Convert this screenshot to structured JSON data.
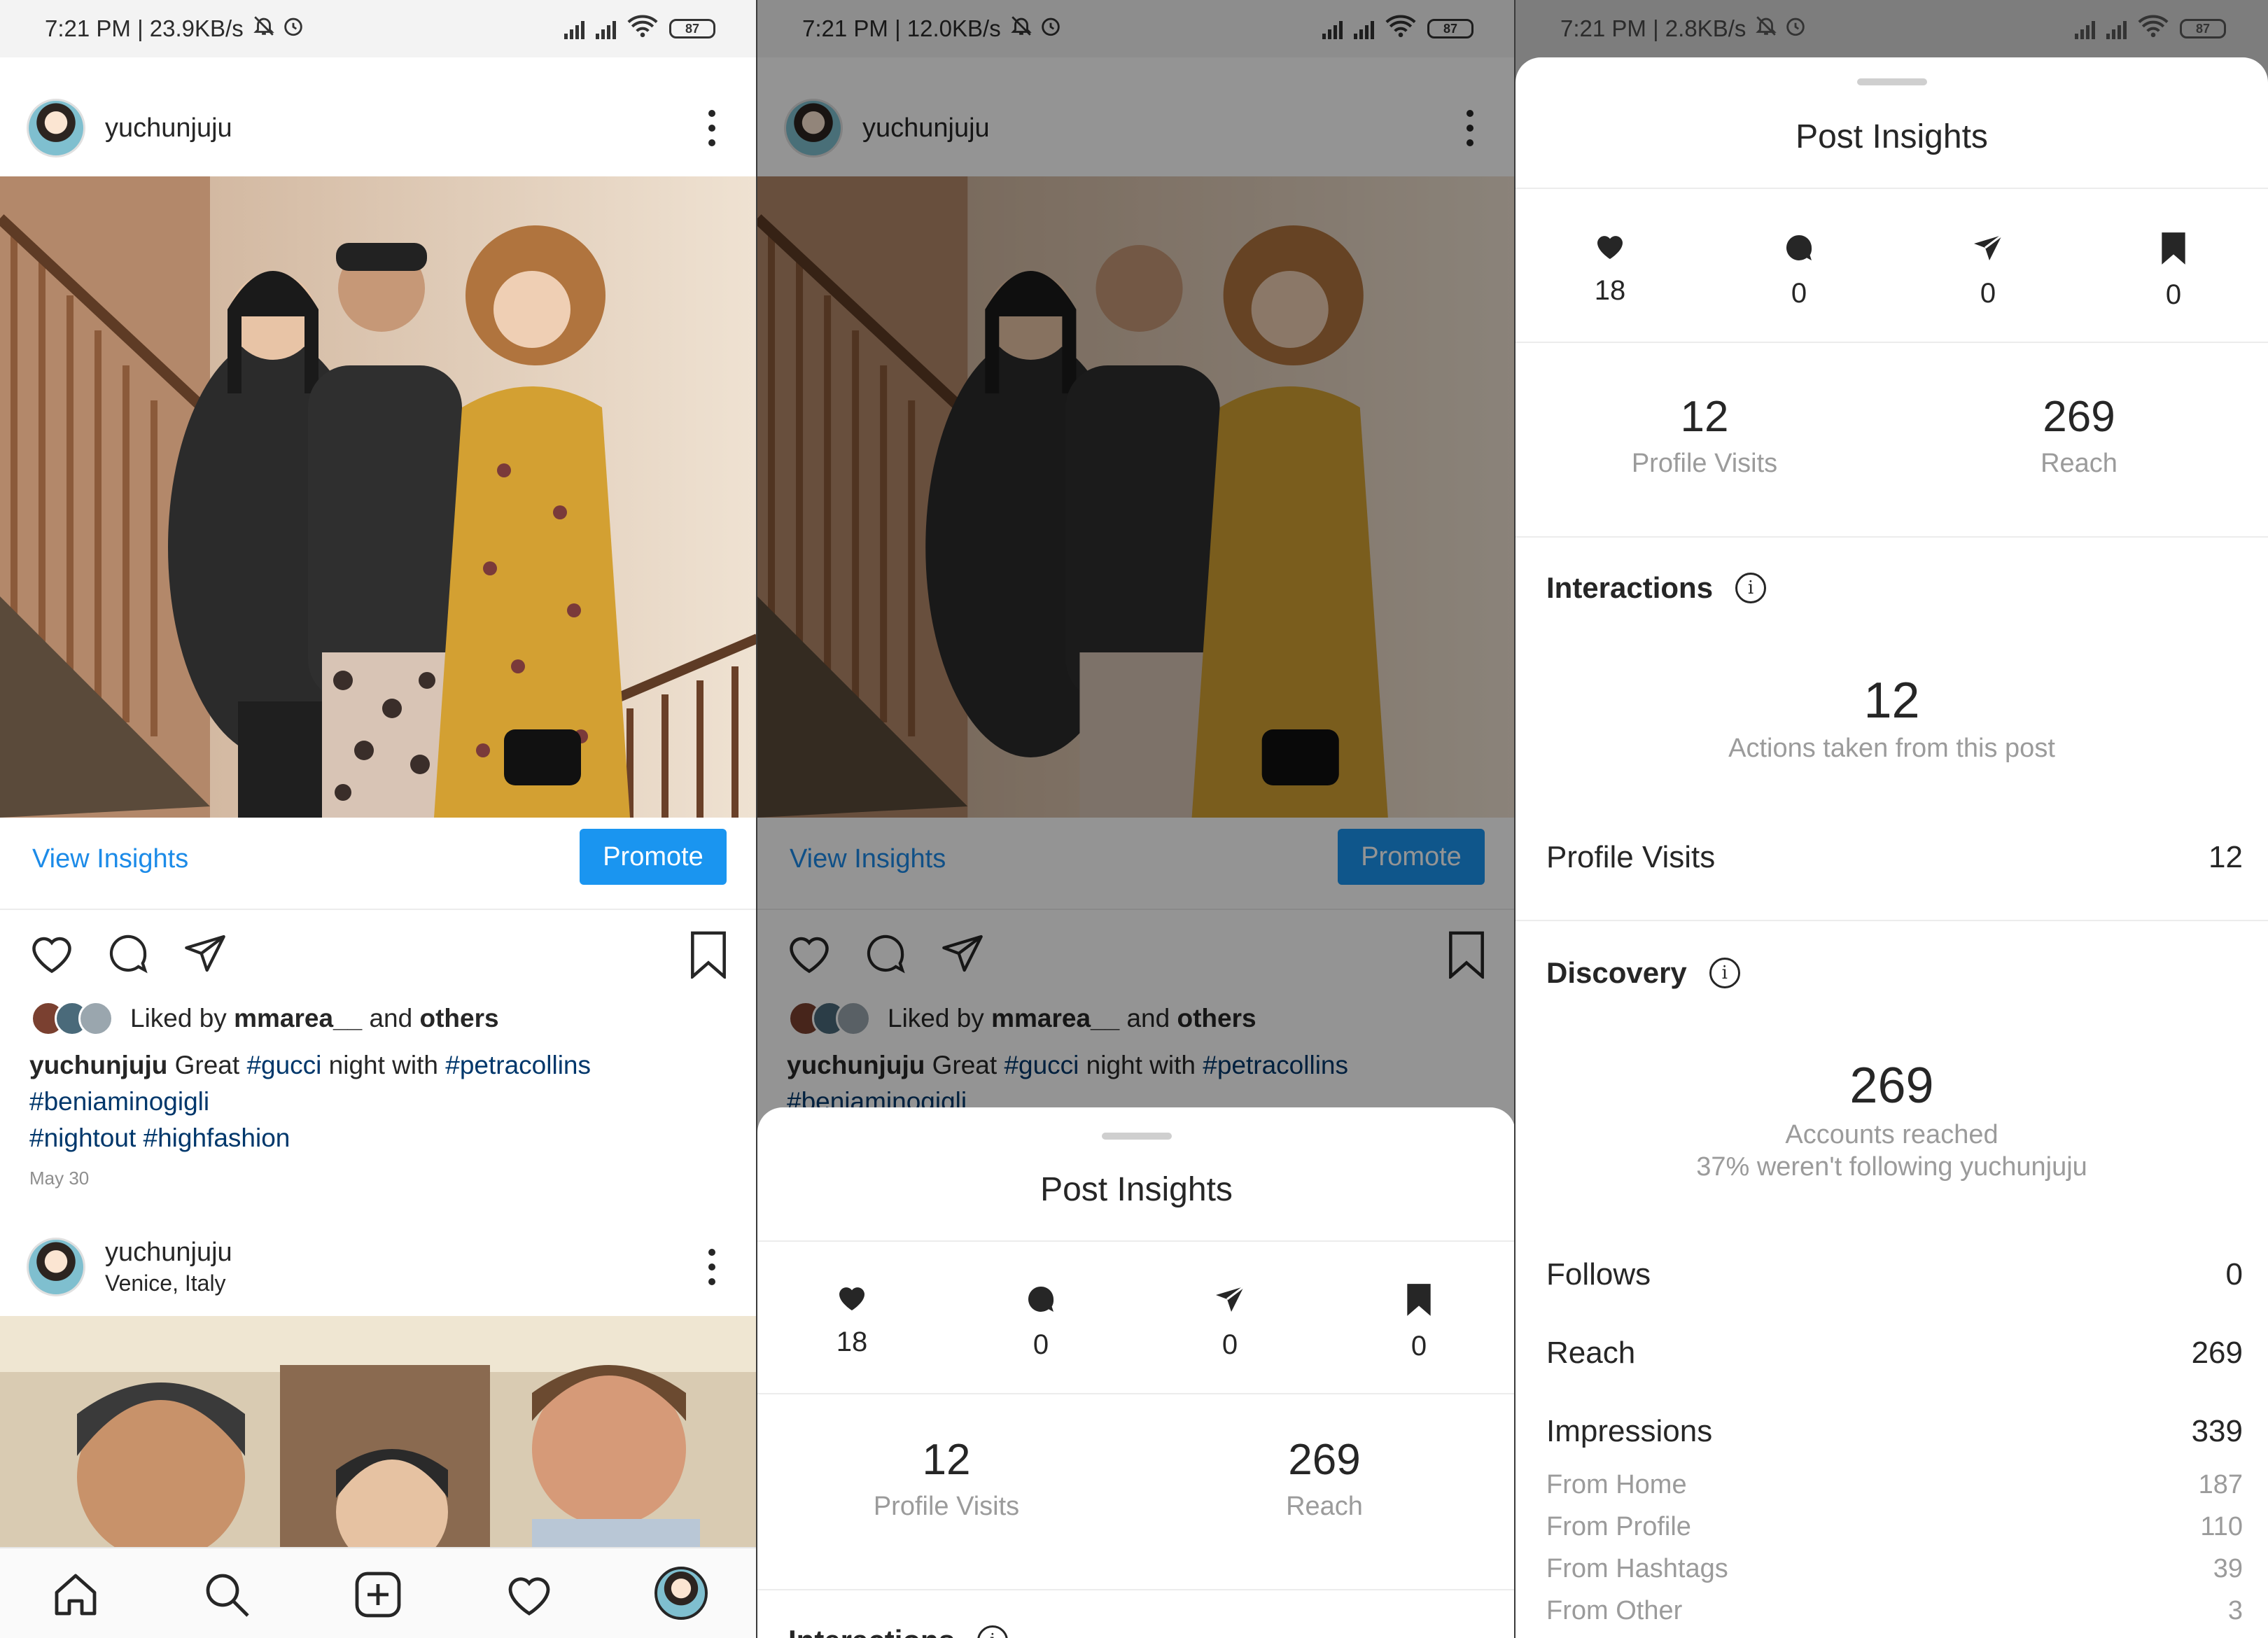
{
  "panel1": {
    "status": "7:21 PM | 23.9KB/s",
    "battery": "87",
    "post1": {
      "username": "yuchunjuju",
      "view_insights": "View Insights",
      "promote": "Promote",
      "liked_prefix": "Liked by ",
      "liked_user": "mmarea__",
      "liked_mid": " and ",
      "liked_others": "others",
      "caption_user": "yuchunjuju",
      "caption_text1": " Great ",
      "tag_gucci": "#gucci",
      "caption_text2": " night with ",
      "tag_petracollins": "#petracollins",
      "tag_beniaminogigli": "#beniaminogigli",
      "tag_nightout": "#nightout",
      "tag_highfashion": "#highfashion",
      "date": "May 30"
    },
    "post2": {
      "username": "yuchunjuju",
      "location": "Venice, Italy"
    }
  },
  "panel2": {
    "status": "7:21 PM | 12.0KB/s",
    "battery": "87",
    "post1": {
      "username": "yuchunjuju",
      "view_insights": "View Insights",
      "promote": "Promote",
      "liked_prefix": "Liked by ",
      "liked_user": "mmarea__",
      "liked_mid": " and ",
      "liked_others": "others",
      "caption_user": "yuchunjuju",
      "caption_text1": " Great ",
      "tag_gucci": "#gucci",
      "caption_text2": " night with ",
      "tag_petracollins": "#petracollins",
      "tag_beniaminogigli": "#beniaminogigli"
    },
    "sheet": {
      "title": "Post Insights",
      "likes": "18",
      "comments": "0",
      "shares": "0",
      "saves": "0",
      "profile_visits_value": "12",
      "profile_visits_label": "Profile Visits",
      "reach_value": "269",
      "reach_label": "Reach",
      "interactions_partial": "Interactions"
    }
  },
  "panel3": {
    "status": "7:21 PM | 2.8KB/s",
    "battery": "87",
    "sheet": {
      "title": "Post Insights",
      "likes": "18",
      "comments": "0",
      "shares": "0",
      "saves": "0",
      "profile_visits_value": "12",
      "profile_visits_label": "Profile Visits",
      "reach_value": "269",
      "reach_label": "Reach",
      "interactions_title": "Interactions",
      "interactions_value": "12",
      "interactions_label": "Actions taken from this post",
      "row_profile_visits_label": "Profile Visits",
      "row_profile_visits_value": "12",
      "discovery_title": "Discovery",
      "discovery_value": "269",
      "discovery_label1": "Accounts reached",
      "discovery_label2": "37% weren't following yuchunjuju",
      "follows_label": "Follows",
      "follows_value": "0",
      "reach_row_label": "Reach",
      "reach_row_value": "269",
      "impressions_label": "Impressions",
      "impressions_value": "339",
      "from_home_label": "From Home",
      "from_home_value": "187",
      "from_profile_label": "From Profile",
      "from_profile_value": "110",
      "from_hashtags_label": "From Hashtags",
      "from_hashtags_value": "39",
      "from_other_label": "From Other",
      "from_other_value": "3"
    }
  },
  "colors": {
    "link_blue": "#1c8be8",
    "promote_blue": "#1a95f0",
    "hashtag_navy": "#00376b",
    "muted_gray": "#9b9b9b"
  }
}
